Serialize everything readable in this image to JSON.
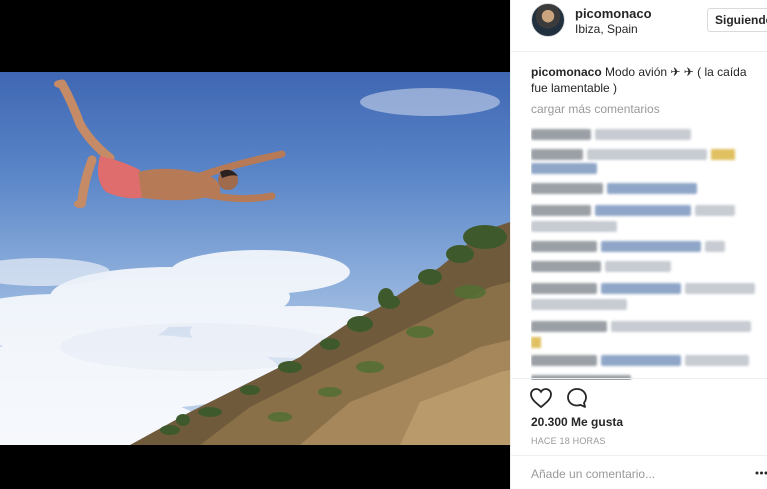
{
  "post": {
    "image_alt": "Man diving off a cliff against a blue sky"
  },
  "header": {
    "username": "picomonaco",
    "location": "Ibiza, Spain",
    "follow_label": "Siguiendo"
  },
  "caption": {
    "username": "picomonaco",
    "text": " Modo avión ✈ ✈ ( la caída fue lamentable )"
  },
  "comments": {
    "load_more": "cargar más comentarios"
  },
  "actions": {
    "like_icon": "heart-icon",
    "comment_icon": "comment-icon"
  },
  "stats": {
    "likes": "20.300 Me gusta",
    "timestamp": "HACE 18 HORAS"
  },
  "add_comment": {
    "placeholder": "Añade un comentario..."
  },
  "colors": {
    "text": "#262626",
    "muted": "#999999",
    "border": "#dbdbdb",
    "sky": "#5b86c8"
  }
}
